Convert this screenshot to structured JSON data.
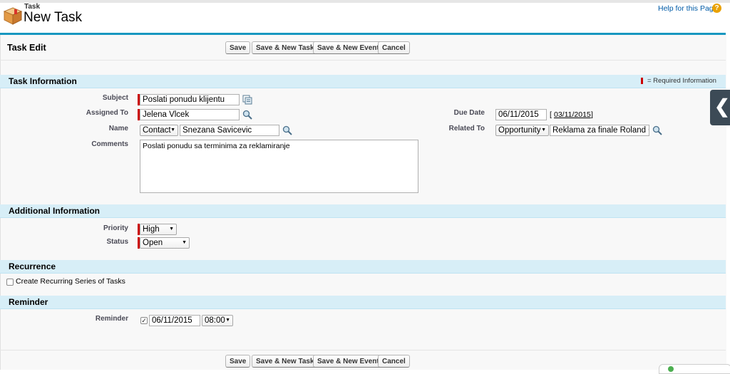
{
  "header": {
    "object_label": "Task",
    "page_title": "New Task",
    "help_link": "Help for this Page",
    "help_icon_glyph": "?"
  },
  "edit_block": {
    "title": "Task Edit"
  },
  "buttons": {
    "save": "Save",
    "save_new_task": "Save & New Task",
    "save_new_event": "Save & New Event",
    "cancel": "Cancel"
  },
  "sections": {
    "task_information": {
      "title": "Task Information",
      "required_note": "= Required Information",
      "subject_label": "Subject",
      "subject_value": "Poslati ponudu klijentu",
      "assigned_to_label": "Assigned To",
      "assigned_to_value": "Jelena Vlcek",
      "name_label": "Name",
      "name_type": "Contact",
      "name_value": "Snezana Savicevic",
      "comments_label": "Comments",
      "comments_value": "Poslati ponudu sa terminima za reklamiranje",
      "due_date_label": "Due Date",
      "due_date_value": "06/11/2015",
      "due_date_today_open": "[",
      "due_date_today": "03/11/2015",
      "due_date_today_close": "]",
      "related_to_label": "Related To",
      "related_to_type": "Opportunity",
      "related_to_value": "Reklama za finale Roland G"
    },
    "additional_information": {
      "title": "Additional Information",
      "priority_label": "Priority",
      "priority_value": "High",
      "status_label": "Status",
      "status_value": "Open"
    },
    "recurrence": {
      "title": "Recurrence",
      "recurring_label": "Create Recurring Series of Tasks"
    },
    "reminder": {
      "title": "Reminder",
      "reminder_label": "Reminder",
      "reminder_checked_glyph": "✓",
      "reminder_date": "06/11/2015",
      "reminder_time": "08:00"
    }
  },
  "side_tab_glyph": "❮",
  "caret_glyph": "▼",
  "colors": {
    "accent_rule": "#1797c0",
    "section_bg": "#d7eef7",
    "required": "#cc0000",
    "help_link": "#015ba7"
  }
}
